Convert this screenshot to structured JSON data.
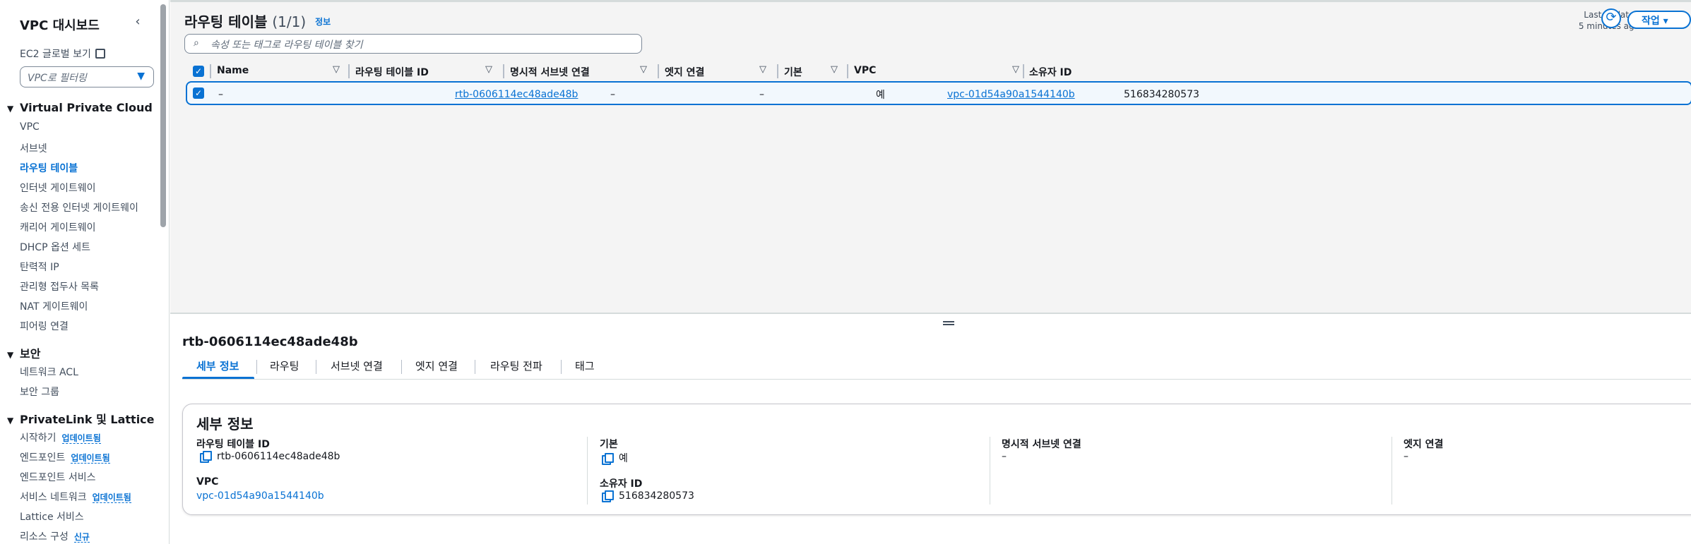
{
  "sidebar": {
    "title": "VPC 대시보드",
    "ec2_global_view": "EC2 글로벌 보기",
    "vpc_filter_placeholder": "VPC로 필터링",
    "sections": {
      "vpc": {
        "title": "Virtual Private Cloud",
        "items": [
          "VPC",
          "서브넷",
          "라우팅 테이블",
          "인터넷 게이트웨이",
          "송신 전용 인터넷 게이트웨이",
          "캐리어 게이트웨이",
          "DHCP 옵션 세트",
          "탄력적 IP",
          "관리형 접두사 목록",
          "NAT 게이트웨이",
          "피어링 연결"
        ],
        "active_item": "라우팅 테이블"
      },
      "security": {
        "title": "보안",
        "items": [
          "네트워크 ACL",
          "보안 그룹"
        ]
      },
      "privatelink": {
        "title": "PrivateLink 및 Lattice",
        "items": [
          "시작하기",
          "엔드포인트",
          "엔드포인트 서비스",
          "서비스 네트워크",
          "Lattice 서비스",
          "리소스 구성"
        ],
        "badges": {
          "start": "업데이트됨",
          "endpoint": "업데이트됨",
          "service_network": "업데이트됨",
          "resource_config": "신규"
        }
      }
    }
  },
  "table": {
    "title": "라우팅 테이블",
    "count": "(1/1)",
    "info_link": "정보",
    "last_updated_line1": "Last updated",
    "last_updated_line2": "5 minutes ago",
    "action_button": "작업",
    "search_placeholder": "속성 또는 태그로 라우팅 테이블 찾기",
    "columns": [
      "Name",
      "라우팅 테이블 ID",
      "명시적 서브넷 연결",
      "엣지 연결",
      "기본",
      "VPC",
      "소유자 ID"
    ],
    "rows": [
      {
        "name": "–",
        "route_table_id": "rtb-0606114ec48ade48b",
        "explicit_subnet": "–",
        "edge": "–",
        "main": "예",
        "vpc": "vpc-01d54a90a1544140b",
        "owner_id": "516834280573"
      }
    ]
  },
  "details": {
    "title": "rtb-0606114ec48ade48b",
    "tabs": [
      "세부 정보",
      "라우팅",
      "서브넷 연결",
      "엣지 연결",
      "라우팅 전파",
      "태그"
    ],
    "active_tab": "세부 정보",
    "card_title": "세부 정보",
    "fields": {
      "route_table_id_label": "라우팅 테이블 ID",
      "route_table_id_value": "rtb-0606114ec48ade48b",
      "main_label": "기본",
      "main_value": "예",
      "explicit_subnet_label": "명시적 서브넷 연결",
      "explicit_subnet_value": "–",
      "edge_label": "엣지 연결",
      "edge_value": "–",
      "vpc_label": "VPC",
      "vpc_value": "vpc-01d54a90a1544140b",
      "owner_label": "소유자 ID",
      "owner_value": "516834280573"
    }
  },
  "colors": {
    "accent": "#0972d3",
    "text": "#16191f",
    "muted": "#414d5c",
    "pane_bg": "#f4f4f4"
  },
  "icons": {
    "collapse": "chevron-left-icon",
    "external": "external-link-icon",
    "caret": "caret-down-icon",
    "search": "search-icon",
    "refresh": "refresh-icon",
    "sort": "sort-icon",
    "copy": "copy-icon",
    "checkbox": "checkbox-checked-icon"
  }
}
